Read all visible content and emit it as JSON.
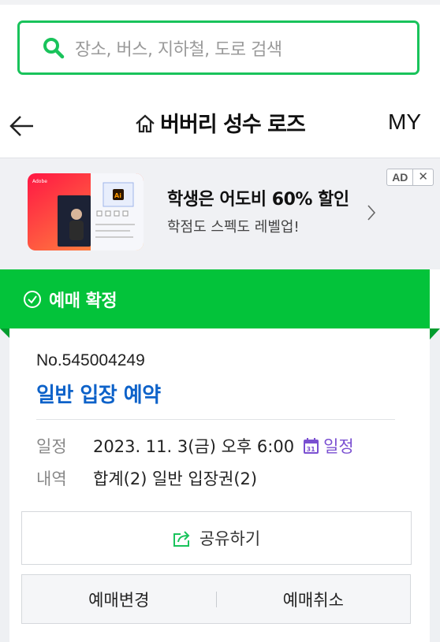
{
  "search": {
    "placeholder": "장소, 버스, 지하철, 도로 검색"
  },
  "header": {
    "title": "버버리 성수 로즈",
    "my_label": "MY"
  },
  "ad": {
    "headline": "학생은 어도비 60% 할인",
    "subtext": "학점도 스펙도 레벨업!",
    "badge": "AD",
    "close_symbol": "✕",
    "thumb_brand": "Adobe",
    "thumb_app": "Ai",
    "colors": {
      "thumb_gradient_start": "#ff1744",
      "thumb_gradient_end": "#ff9a3d"
    }
  },
  "status": {
    "label": "예매 확정",
    "color": "#03c33a"
  },
  "booking": {
    "number": "No.545004249",
    "name": "일반 입장 예약",
    "date_label": "일정",
    "date_value": "2023. 11. 3(금) 오후 6:00",
    "calendar_icon_text": "31",
    "calendar_link": "일정",
    "detail_label": "내역",
    "detail_value": "합계(2) 일반 입장권(2)"
  },
  "actions": {
    "share": "공유하기",
    "change": "예매변경",
    "cancel": "예매취소"
  },
  "icons": [
    "search-icon",
    "back-arrow-icon",
    "home-icon",
    "chevron-right-icon",
    "check-circle-icon",
    "calendar-icon",
    "share-icon"
  ]
}
